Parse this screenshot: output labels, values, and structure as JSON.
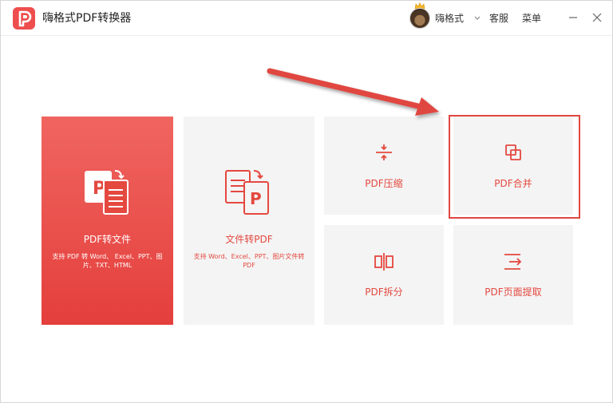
{
  "app": {
    "title": "嗨格式PDF转换器",
    "logo_icon": "pdf-p-logo-icon",
    "accent_color": "#e4483f"
  },
  "header": {
    "username": "嗨格式",
    "avatar_icon": "avatar-with-crown",
    "service_label": "客服",
    "menu_label": "菜单"
  },
  "tiles": [
    {
      "id": "pdf-to-file",
      "label": "PDF转文件",
      "desc": "支持 PDF 转 Word、 Excel、PPT、图片、TXT、HTML",
      "icon": "pdf-to-document-icon",
      "selected": true
    },
    {
      "id": "file-to-pdf",
      "label": "文件转PDF",
      "desc": "支持 Word、Excel、PPT、图片文件转 PDF",
      "icon": "document-to-pdf-icon"
    },
    {
      "id": "compress",
      "label": "PDF压缩",
      "icon": "compress-icon"
    },
    {
      "id": "merge",
      "label": "PDF合并",
      "icon": "merge-icon",
      "highlighted": true
    },
    {
      "id": "split",
      "label": "PDF拆分",
      "icon": "split-icon"
    },
    {
      "id": "extract",
      "label": "PDF页面提取",
      "icon": "page-extract-icon"
    }
  ],
  "annotation": {
    "arrow_color": "#e0463f",
    "target": "merge"
  }
}
